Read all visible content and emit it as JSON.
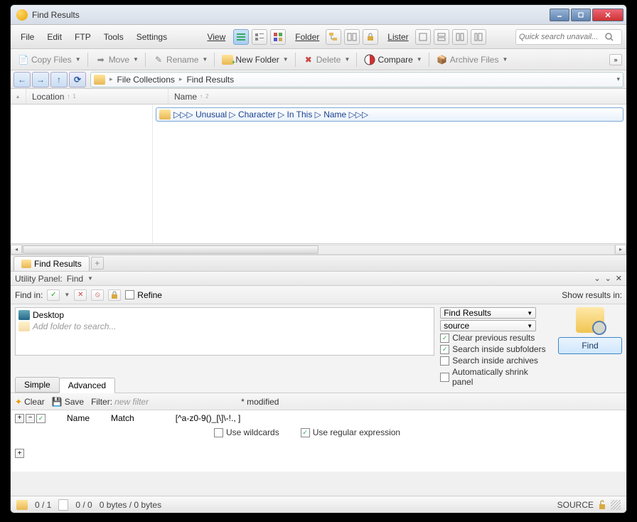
{
  "title": "Find Results",
  "menu": {
    "file": "File",
    "edit": "Edit",
    "ftp": "FTP",
    "tools": "Tools",
    "settings": "Settings",
    "view": "View",
    "folder": "Folder",
    "lister": "Lister"
  },
  "search_placeholder": "Quick search unavail...",
  "toolbar2": {
    "copy": "Copy Files",
    "move": "Move",
    "rename": "Rename",
    "newfolder": "New Folder",
    "delete": "Delete",
    "compare": "Compare",
    "archive": "Archive Files"
  },
  "breadcrumb": {
    "root": "File Collections",
    "current": "Find Results"
  },
  "columns": {
    "loc": "Location",
    "name": "Name"
  },
  "result_filename": "▷▷▷ Unusual ▷ Character ▷ In This ▷ Name ▷▷▷",
  "tab_label": "Find Results",
  "utility": {
    "panel": "Utility Panel:",
    "find": "Find"
  },
  "findbar": {
    "findin": "Find in:",
    "refine": "Refine",
    "showresults": "Show results in:"
  },
  "folderlist": {
    "desktop": "Desktop",
    "addhint": "Add folder to search..."
  },
  "combos": {
    "findresults": "Find Results",
    "source": "source"
  },
  "checks": {
    "clear": "Clear previous results",
    "subfolders": "Search inside subfolders",
    "archives": "Search inside archives",
    "shrink": "Automatically shrink panel"
  },
  "findbtn": "Find",
  "satabs": {
    "simple": "Simple",
    "advanced": "Advanced"
  },
  "filterbar": {
    "clear": "Clear",
    "save": "Save",
    "filter": "Filter:",
    "newfilter": "new filter",
    "modified": "* modified"
  },
  "advheaders": {
    "name": "Name",
    "match": "Match"
  },
  "adv": {
    "pattern": "[^a-z0-9()_[\\]\\-!., ]",
    "wildcards": "Use wildcards",
    "regex": "Use regular expression"
  },
  "status": {
    "folders": "0 / 1",
    "files": "0 / 0",
    "bytes": "0 bytes / 0 bytes",
    "source": "SOURCE"
  }
}
